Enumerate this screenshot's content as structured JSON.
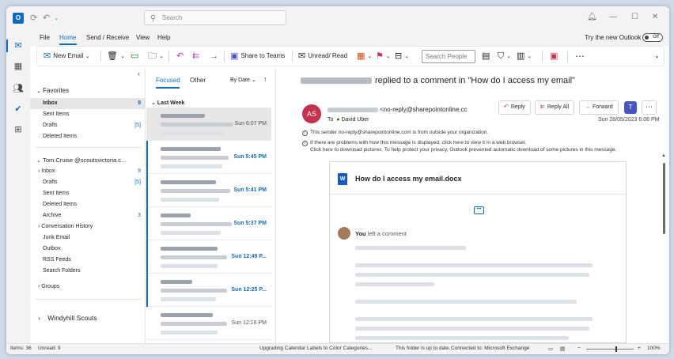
{
  "titlebar": {
    "search_placeholder": "Search"
  },
  "menubar": {
    "items": [
      "File",
      "Home",
      "Send / Receive",
      "View",
      "Help"
    ],
    "try_new": "Try the new Outlook",
    "toggle": "Off"
  },
  "ribbon": {
    "new_email": "New Email",
    "share_to_teams": "Share to Teams",
    "unread_read": "Unread/ Read",
    "search_people": "Search People"
  },
  "folders": {
    "favorites_label": "Favorites",
    "favorites": [
      {
        "label": "Inbox",
        "count": "9"
      },
      {
        "label": "Sent Items",
        "count": ""
      },
      {
        "label": "Drafts",
        "count": "[5]"
      },
      {
        "label": "Deleted Items",
        "count": ""
      }
    ],
    "account": "Tom.Cruise @scoutsvictoria.c...",
    "account_items": [
      {
        "label": "Inbox",
        "count": "9",
        "arrow": "true"
      },
      {
        "label": "Drafts",
        "count": "[5]",
        "arrow": ""
      },
      {
        "label": "Sent Items",
        "count": "",
        "arrow": ""
      },
      {
        "label": "Deleted Items",
        "count": "",
        "arrow": ""
      },
      {
        "label": "Archive",
        "count": "3",
        "arrow": ""
      },
      {
        "label": "Conversation History",
        "count": "",
        "arrow": "true"
      },
      {
        "label": "Junk Email",
        "count": "",
        "arrow": ""
      },
      {
        "label": "Outbox",
        "count": "",
        "arrow": ""
      },
      {
        "label": "RSS Feeds",
        "count": "",
        "arrow": ""
      },
      {
        "label": "Search Folders",
        "count": "",
        "arrow": ""
      }
    ],
    "groups": "Groups",
    "other_account": "Windyhill Scouts"
  },
  "message_list": {
    "tab_focused": "Focused",
    "tab_other": "Other",
    "sort": "By Date",
    "group": "Last Week",
    "items": [
      {
        "time": "Sun 6:07 PM"
      },
      {
        "time": "Sun 5:45 PM"
      },
      {
        "time": "Sun 5:41 PM"
      },
      {
        "time": "Sun 5:37 PM"
      },
      {
        "time": "Sun 12:49 P..."
      },
      {
        "time": "Sun 12:25 P..."
      },
      {
        "time": "Sun 12:16 PM"
      }
    ]
  },
  "reading": {
    "subject": "replied to a comment in \"How do I access my email\"",
    "avatar": "AS",
    "from_email": "<no-reply@sharepointonline.cc",
    "to_label": "To",
    "to_name": "David Uber",
    "reply": "Reply",
    "reply_all": "Reply All",
    "forward": "Forward",
    "date": "Sun 28/05/2023 6:06 PM",
    "info1": "This sender no-reply@sharepointonline.com is from outside your organization.",
    "info2": "If there are problems with how this message is displayed, click here to view it in a web browser.",
    "info3": "Click here to download pictures. To help protect your privacy, Outlook prevented automatic download of some pictures in this message.",
    "doc_title": "How do I access my email.docx",
    "you": "You",
    "you_suffix": "left a comment"
  },
  "status": {
    "items": "Items: 36",
    "unread": "Unread: 9",
    "upgrading": "Upgrading Calendar Labels to Color Categories...",
    "uptodate": "This folder is up to date.",
    "connected": "Connected to: Microsoft Exchange",
    "zoom": "100%"
  },
  "colors": {
    "accent": "#0f6cbd",
    "avatar": "#c4314b"
  }
}
